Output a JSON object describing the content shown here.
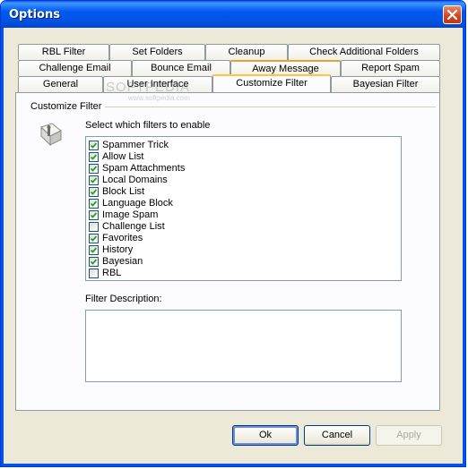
{
  "window": {
    "title": "Options"
  },
  "tabs": {
    "row1": [
      {
        "label": "RBL Filter"
      },
      {
        "label": "Set Folders"
      },
      {
        "label": "Cleanup"
      },
      {
        "label": "Check Additional Folders"
      }
    ],
    "row2": [
      {
        "label": "Challenge Email"
      },
      {
        "label": "Bounce Email"
      },
      {
        "label": "Away Message"
      },
      {
        "label": "Report Spam"
      }
    ],
    "row3": [
      {
        "label": "General"
      },
      {
        "label": "User Interface"
      },
      {
        "label": "Customize Filter"
      },
      {
        "label": "Bayesian Filter"
      }
    ],
    "active": "Customize Filter"
  },
  "panel": {
    "group_label": "Customize Filter",
    "select_label": "Select which filters to enable",
    "filters": [
      {
        "label": "Spammer Trick",
        "checked": true
      },
      {
        "label": "Allow List",
        "checked": true
      },
      {
        "label": "Spam Attachments",
        "checked": true
      },
      {
        "label": "Local Domains",
        "checked": true
      },
      {
        "label": "Block List",
        "checked": true
      },
      {
        "label": "Language Block",
        "checked": true
      },
      {
        "label": "Image Spam",
        "checked": true
      },
      {
        "label": "Challenge List",
        "checked": false
      },
      {
        "label": "Favorites",
        "checked": true
      },
      {
        "label": "History",
        "checked": true
      },
      {
        "label": "Bayesian",
        "checked": true
      },
      {
        "label": "RBL",
        "checked": false
      }
    ],
    "description_label": "Filter Description:",
    "description_value": ""
  },
  "buttons": {
    "ok": "Ok",
    "cancel": "Cancel",
    "apply": "Apply"
  },
  "watermark": {
    "text": "SOFTPEDIA",
    "sub": "www.softpedia.com"
  },
  "colors": {
    "titlebar": "#0055e5",
    "tab_hot": "#e9a32b",
    "check": "#21a121",
    "close": "#d4431c"
  }
}
